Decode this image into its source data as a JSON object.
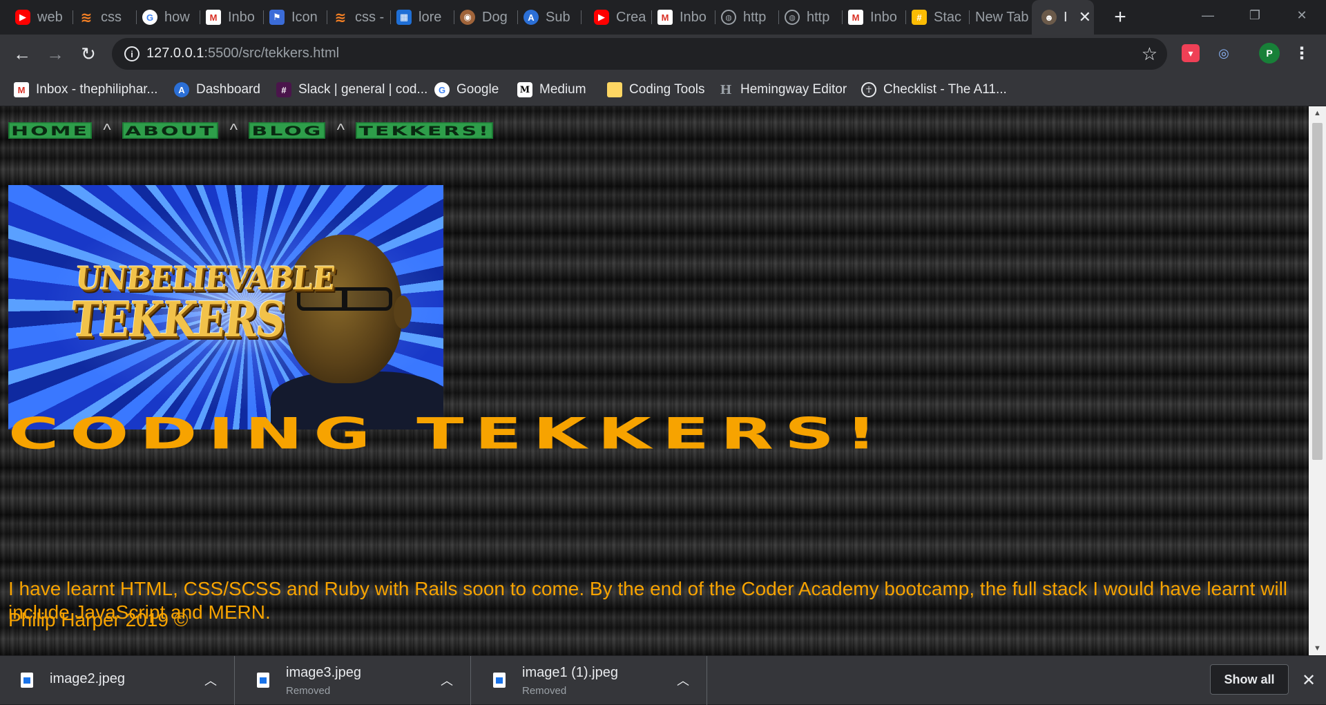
{
  "tabs": [
    {
      "title": "web",
      "icon": "youtube-icon"
    },
    {
      "title": "css",
      "icon": "stackoverflow-icon"
    },
    {
      "title": "how",
      "icon": "google-icon"
    },
    {
      "title": "Inbo",
      "icon": "gmail-icon"
    },
    {
      "title": "Icon",
      "icon": "flag-icon"
    },
    {
      "title": "css -",
      "icon": "stackoverflow-icon"
    },
    {
      "title": "lore",
      "icon": "grid-icon"
    },
    {
      "title": "Dog",
      "icon": "dog-icon"
    },
    {
      "title": "Sub",
      "icon": "a-icon"
    },
    {
      "title": "Crea",
      "icon": "youtube-icon"
    },
    {
      "title": "Inbo",
      "icon": "gmail-icon"
    },
    {
      "title": "http",
      "icon": "globe-icon"
    },
    {
      "title": "http",
      "icon": "globe-icon"
    },
    {
      "title": "Inbo",
      "icon": "gmail-icon"
    },
    {
      "title": "Stac",
      "icon": "note-icon"
    },
    {
      "title": "New Tab",
      "icon": ""
    },
    {
      "title": "I",
      "icon": "face-icon",
      "active": true
    }
  ],
  "toolbar": {
    "url_host": "127.0.0.1",
    "url_rest": ":5500/src/tekkers.html",
    "profile_initial": "P"
  },
  "bookmarks": [
    {
      "label": "Inbox - thephiliphar...",
      "icon": "gmail-icon"
    },
    {
      "label": "Dashboard",
      "icon": "a-icon"
    },
    {
      "label": "Slack | general | cod...",
      "icon": "slack-icon"
    },
    {
      "label": "Google",
      "icon": "google-icon"
    },
    {
      "label": "Medium",
      "icon": "medium-icon"
    },
    {
      "label": "Coding Tools",
      "icon": "folder-icon"
    },
    {
      "label": "Hemingway Editor",
      "icon": "hemingway-icon"
    },
    {
      "label": "Checklist - The A11...",
      "icon": "accessibility-icon"
    }
  ],
  "page": {
    "nav": [
      "HOME",
      "ABOUT",
      "BLOG",
      "TEKKERS!"
    ],
    "nav_separator": "^",
    "hero_logo_line1": "UNBELIEVABLE",
    "hero_logo_line2": "TEKKERS",
    "title": "CODING TEKKERS!",
    "text": "I have learnt HTML, CSS/SCSS and Ruby with Rails soon to come. By the end of the Coder Academy bootcamp, the full stack I would have learnt will include JavaScript and MERN.",
    "footer": "Philip Harper 2019 ©"
  },
  "downloads": [
    {
      "name": "image2.jpeg",
      "status": ""
    },
    {
      "name": "image3.jpeg",
      "status": "Removed"
    },
    {
      "name": "image1 (1).jpeg",
      "status": "Removed"
    }
  ],
  "show_all_label": "Show all",
  "colors": {
    "nav_green": "#2e9e4a",
    "accent_orange": "#f7a300"
  }
}
